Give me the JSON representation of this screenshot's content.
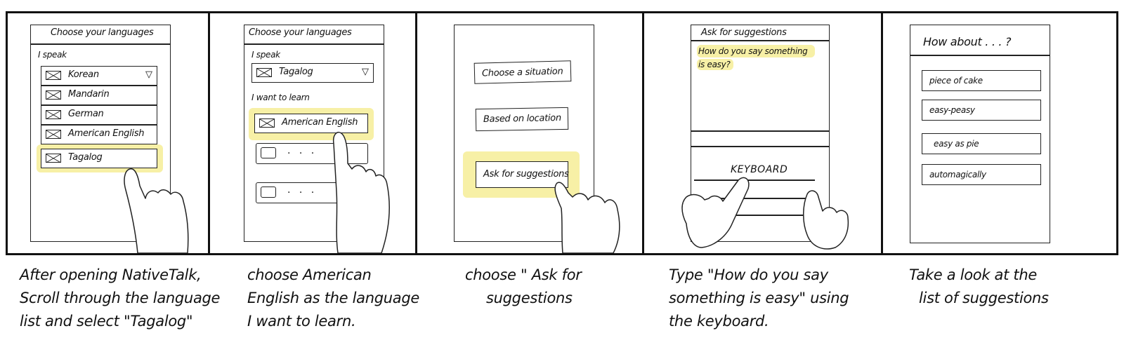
{
  "panels": [
    {
      "title": "Choose your languages",
      "speak_label": "I speak",
      "languages": [
        "Korean",
        "Mandarin",
        "German",
        "American English",
        "Tagalog"
      ],
      "caption": [
        "After opening NativeTalk,",
        "Scroll through the language",
        "list and select \"Tagalog\""
      ]
    },
    {
      "title": "Choose your languages",
      "speak_label": "I speak",
      "speak_value": "Tagalog",
      "learn_label": "I want to learn",
      "learn_value": "American English",
      "placeholder_dots": ". . .",
      "caption": [
        "choose American",
        "English as the language",
        "I want to learn."
      ]
    },
    {
      "buttons": [
        "Choose a situation",
        "Based on location",
        "Ask for suggestions"
      ],
      "caption": [
        "choose \" Ask for",
        "suggestions"
      ]
    },
    {
      "title": "Ask for suggestions",
      "query": [
        "How do you say something",
        "is easy?"
      ],
      "keyboard_label": "KEYBOARD",
      "caption": [
        "Type \"How do you say",
        "something is easy\" using",
        "the keyboard."
      ]
    },
    {
      "title": "How about . . . ?",
      "suggestions": [
        "piece of cake",
        "easy-peasy",
        "easy as pie",
        "automagically"
      ],
      "caption": [
        "Take a look at the",
        "list of suggestions"
      ]
    }
  ],
  "colors": {
    "highlight": "#f7f0a6",
    "ink": "#111111"
  }
}
